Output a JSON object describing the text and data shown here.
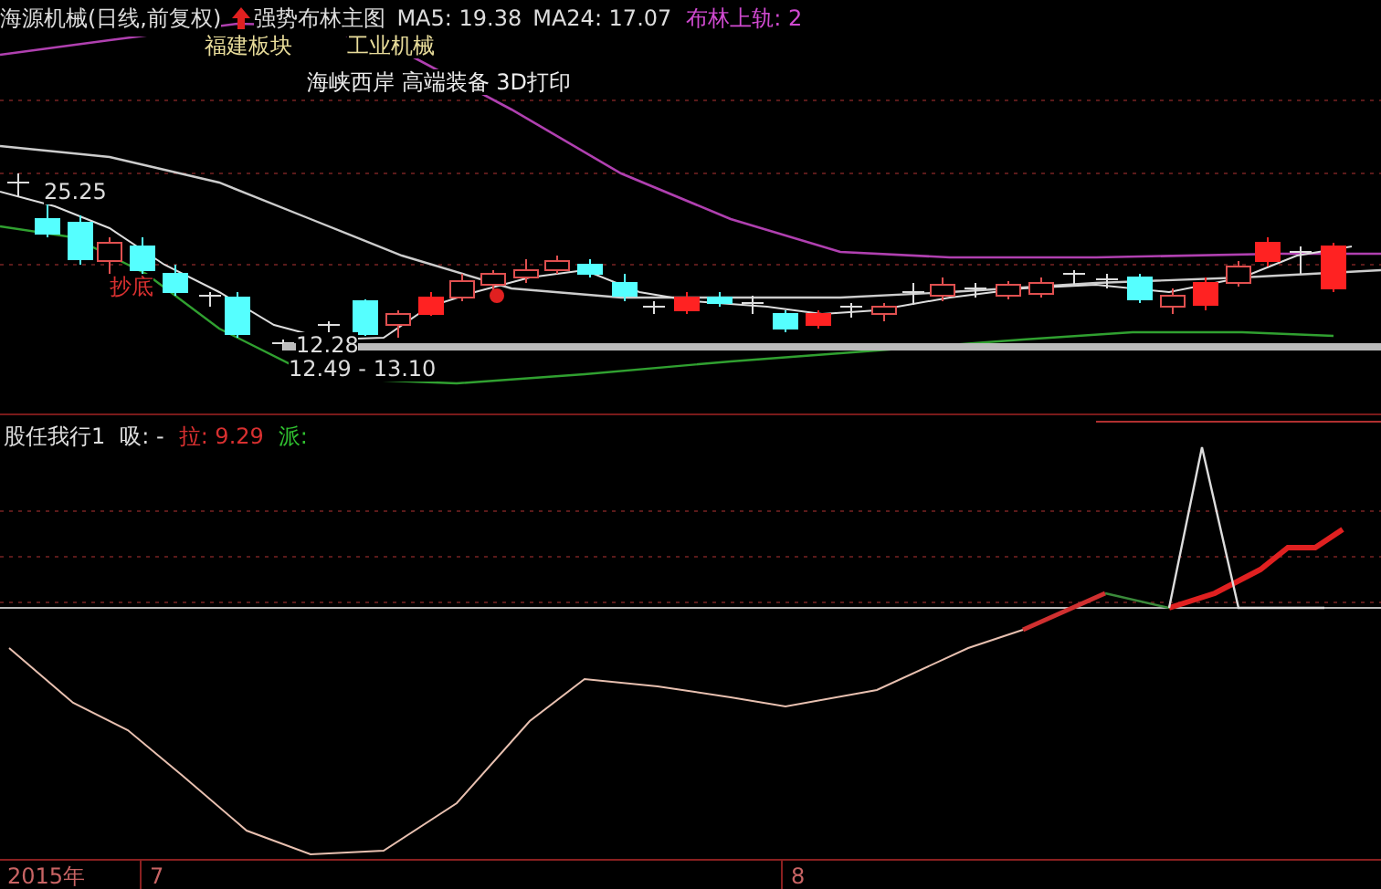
{
  "title_bar": {
    "stock": "海源机械(日线,前复权)",
    "indicator": "强势布林主图",
    "ma5": "MA5: 19.38",
    "ma24": "MA24: 17.07",
    "boll_upper": "布林上轨: 2"
  },
  "tags": [
    {
      "text": "福建板块",
      "kind": "sector"
    },
    {
      "text": "工业机械",
      "kind": "sector"
    },
    {
      "text": "海峡西岸 高端装备 3D打印",
      "kind": "concept"
    }
  ],
  "price_labels": [
    {
      "text": "25.25",
      "kind": "price"
    },
    {
      "text": "抄底",
      "kind": "signal"
    },
    {
      "text": "12.28",
      "kind": "price"
    },
    {
      "text": "12.49 - 13.10",
      "kind": "price"
    }
  ],
  "lower_panel": {
    "title": "股任我行1",
    "xi": "吸: -",
    "la": "拉: 9.29",
    "pai": "派:"
  },
  "axis": [
    "2015年",
    "7",
    "8"
  ]
}
